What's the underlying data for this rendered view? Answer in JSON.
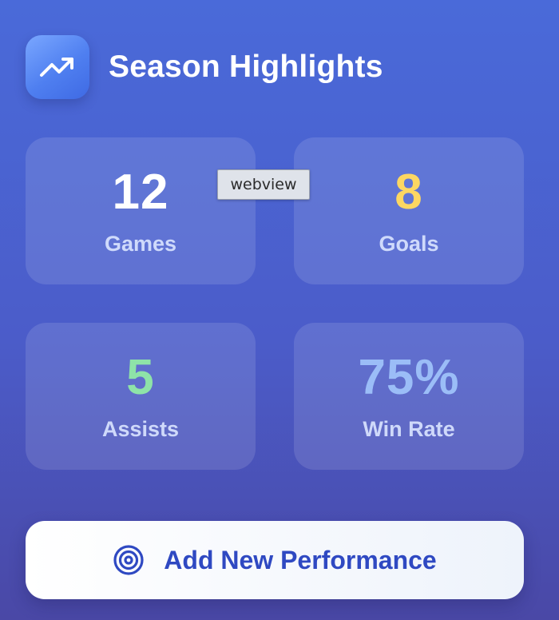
{
  "header": {
    "title": "Season Highlights",
    "icon": "trending-up-icon"
  },
  "stats": {
    "games": {
      "value": "12",
      "label": "Games",
      "color": "#ffffff"
    },
    "goals": {
      "value": "8",
      "label": "Goals",
      "color": "#fcd762"
    },
    "assists": {
      "value": "5",
      "label": "Assists",
      "color": "#8ee3a8"
    },
    "win_rate": {
      "value": "75%",
      "label": "Win Rate",
      "color": "#9bbdf7"
    }
  },
  "tooltip": {
    "text": "webview"
  },
  "add_button": {
    "label": "Add New Performance",
    "icon": "target-icon",
    "color": "#2f49c2"
  }
}
